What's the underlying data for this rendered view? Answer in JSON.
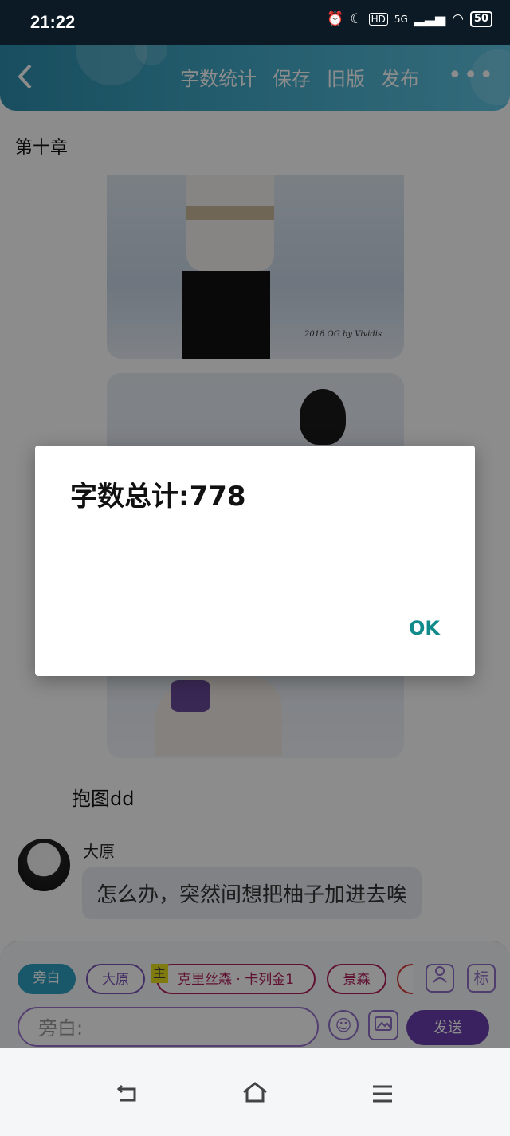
{
  "status_bar": {
    "time": "21:22",
    "signal": "5G",
    "battery": "50"
  },
  "header": {
    "back_icon": "chevron-left-icon",
    "menu": [
      "字数统计",
      "保存",
      "旧版",
      "发布"
    ],
    "more": "•••"
  },
  "chapter": {
    "title": "第十章"
  },
  "content": {
    "image_watermark": "2018 OG by Vividis",
    "caption": "抱图dd",
    "message": {
      "speaker": "大原",
      "text": "怎么办，突然间想把柚子加进去唉"
    }
  },
  "dialog": {
    "message": "字数总计:778",
    "ok": "OK"
  },
  "composer": {
    "chips": [
      "旁白",
      "大原",
      "克里丝森 · 卡列金1",
      "景森"
    ],
    "main_tag": "主",
    "tag_button": "标",
    "input_placeholder": "旁白:",
    "send": "发送"
  },
  "colors": {
    "accent": "#2fa0c3",
    "purple": "#6a3fb0",
    "teal_ok": "#118a8c"
  }
}
